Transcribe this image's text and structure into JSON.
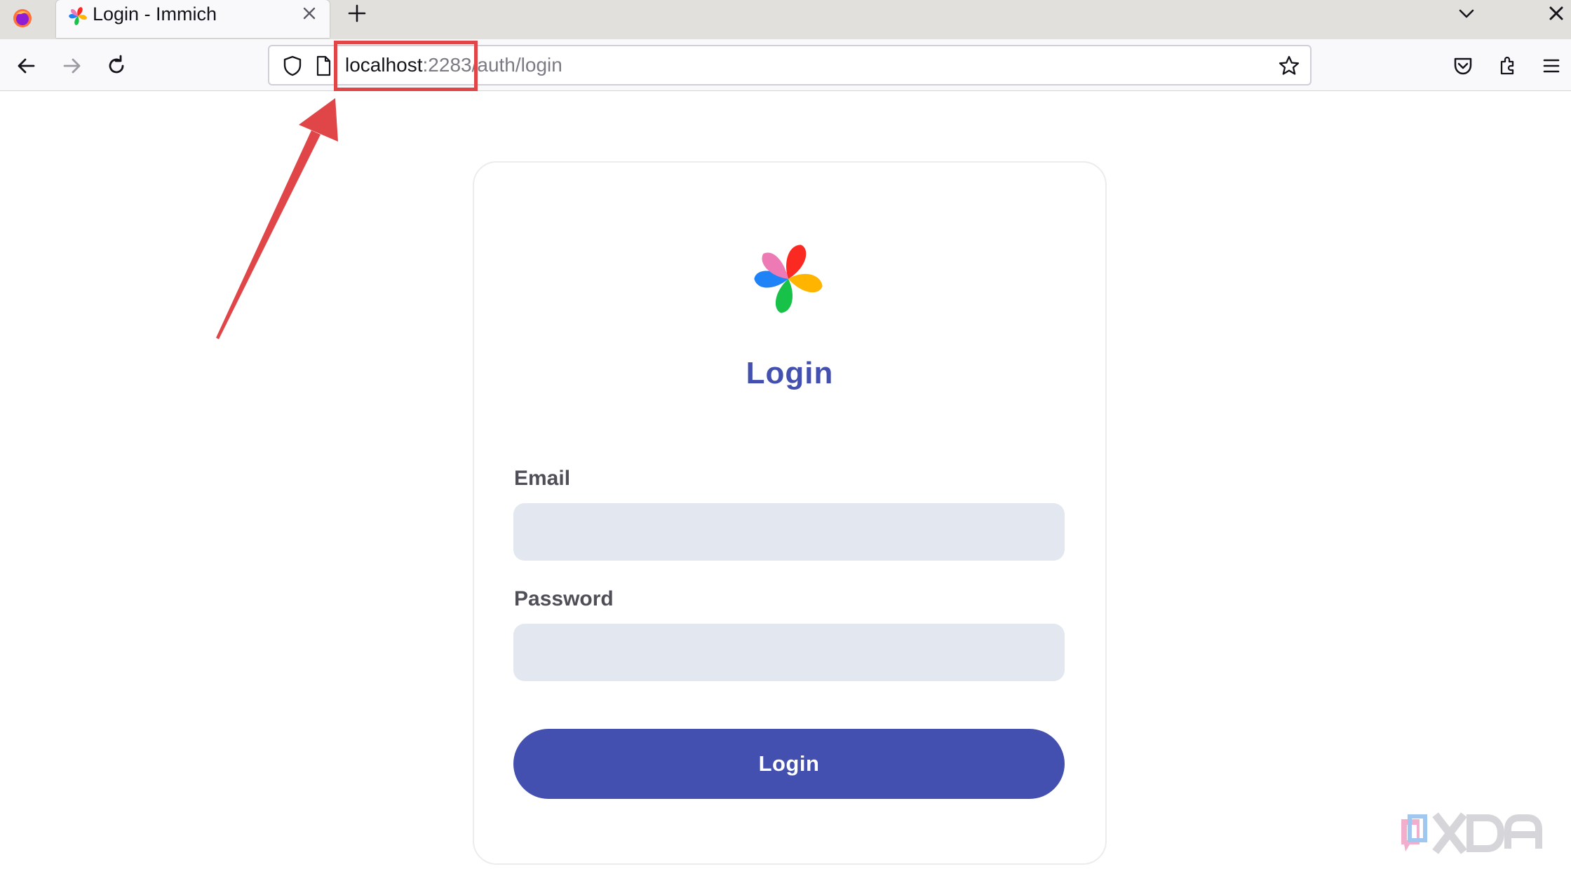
{
  "browser": {
    "tab": {
      "title": "Login - Immich"
    },
    "url": {
      "host": "localhost",
      "port": ":2283",
      "path": "/auth/login"
    }
  },
  "page": {
    "heading": "Login",
    "email_label": "Email",
    "email_value": "",
    "password_label": "Password",
    "password_value": "",
    "login_button_label": "Login"
  },
  "colors": {
    "accent": "#4350af",
    "input_bg": "#e2e7f0",
    "annotation": "#e04648"
  },
  "icons": [
    "firefox-icon",
    "immich-favicon",
    "tab-close-icon",
    "new-tab-icon",
    "tab-list-icon",
    "window-close-icon",
    "back-arrow-icon",
    "forward-arrow-icon",
    "reload-icon",
    "shield-icon",
    "page-icon",
    "bookmark-star-icon",
    "pocket-icon",
    "extensions-icon",
    "menu-icon",
    "immich-logo",
    "annotation-arrow",
    "xda-watermark"
  ]
}
